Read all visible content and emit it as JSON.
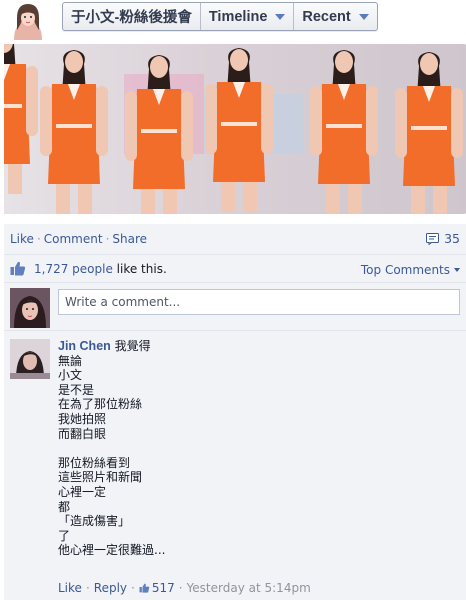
{
  "header": {
    "page_name": "于小文-粉絲後援會",
    "timeline_label": "Timeline",
    "recent_label": "Recent"
  },
  "actions": {
    "like": "Like",
    "comment": "Comment",
    "share": "Share",
    "comment_count": "35"
  },
  "likes": {
    "count": "1,727 people",
    "suffix": " like this.",
    "top_comments": "Top Comments"
  },
  "composer": {
    "placeholder": "Write a comment..."
  },
  "comment": {
    "author": "Jin Chen",
    "lines": [
      "我覺得",
      "無論",
      "小文",
      "是不是",
      "在為了那位粉絲",
      "我她拍照",
      "而翻白眼",
      "",
      "那位粉絲看到",
      "這些照片和新聞",
      "心裡一定",
      "都",
      "「造成傷害」",
      "了",
      "他心裡一定很難過..."
    ],
    "like": "Like",
    "reply": "Reply",
    "like_count": "517",
    "time": "Yesterday at 5:14pm"
  },
  "icons": {
    "page_avatar": "page-avatar-photo",
    "comment_count": "speech-bubble-icon",
    "likes": "thumbs-up-icon",
    "comment_likes": "thumbs-up-icon"
  },
  "colors": {
    "link": "#3b5998",
    "ufi_background": "#f1f3f7",
    "jersey": "#f36d2a"
  }
}
